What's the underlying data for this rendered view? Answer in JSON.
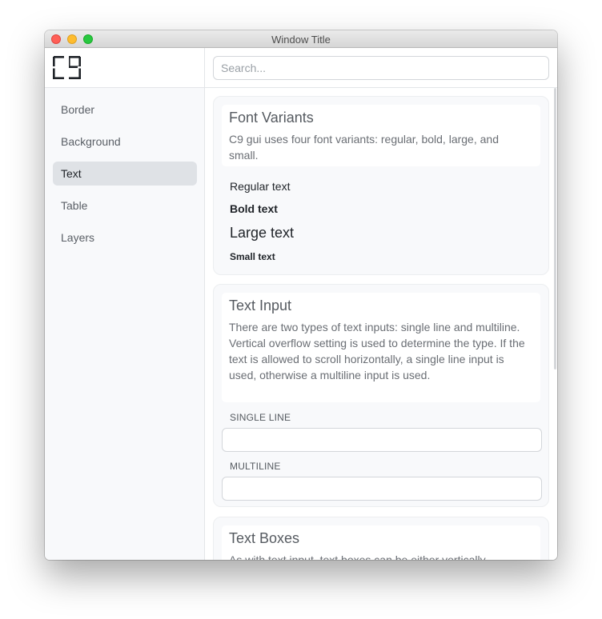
{
  "window": {
    "title": "Window Title"
  },
  "sidebar": {
    "logo_icon": "c9-logo-icon",
    "items": [
      {
        "label": "Border",
        "active": false
      },
      {
        "label": "Background",
        "active": false
      },
      {
        "label": "Text",
        "active": true
      },
      {
        "label": "Table",
        "active": false
      },
      {
        "label": "Layers",
        "active": false
      }
    ]
  },
  "search": {
    "placeholder": "Search...",
    "value": ""
  },
  "sections": {
    "font_variants": {
      "title": "Font Variants",
      "description": "C9 gui uses four font variants: regular, bold, large, and small.",
      "samples": {
        "regular": "Regular text",
        "bold": "Bold text",
        "large": "Large text",
        "small": "Small text"
      }
    },
    "text_input": {
      "title": "Text Input",
      "description": "There are two types of text inputs: single line and multiline. Vertical overflow setting is used to determine the type. If the text is allowed to scroll horizontally, a single line input is used, otherwise a multiline input is used.",
      "single_line_label": "SINGLE LINE",
      "multiline_label": "MULTILINE"
    },
    "text_boxes": {
      "title": "Text Boxes",
      "description": "As with text input, text boxes can be either vertically"
    }
  },
  "colors": {
    "accent_active": "#dfe2e6",
    "sidebar_bg": "#f8f9fb",
    "traffic_red": "#ff5f57",
    "traffic_yellow": "#febc2e",
    "traffic_green": "#28c840"
  }
}
